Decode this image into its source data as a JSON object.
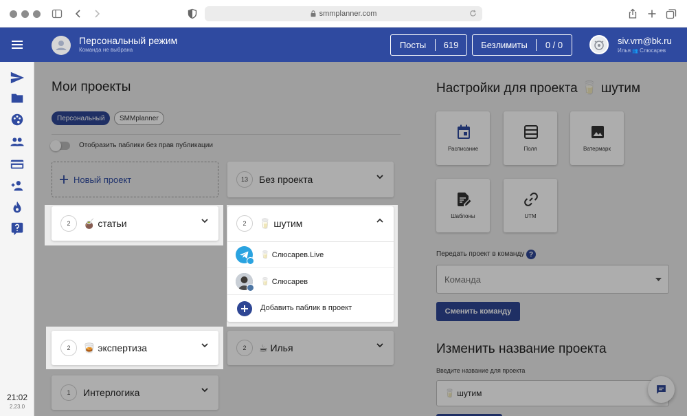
{
  "browser": {
    "url": "smmplanner.com"
  },
  "header": {
    "mode_title": "Персональный режим",
    "mode_subtitle": "Команда не выбрана",
    "posts_label": "Посты",
    "posts_count": "619",
    "unlimited_label": "Безлимиты",
    "unlimited_count": "0 / 0",
    "user_email": "siv.vrn@bk.ru",
    "user_name": "Илья",
    "user_team": "Слюсарев"
  },
  "sidebar": {
    "clock": "21:02",
    "version": "2.23.0"
  },
  "projects": {
    "title": "Мои проекты",
    "chips": [
      "Персональный",
      "SMMplanner"
    ],
    "toggle_label": "Отобразить паблики без прав публикации",
    "new_project": "Новый проект",
    "cards": [
      {
        "count": "13",
        "name": "Без проекта"
      },
      {
        "count": "2",
        "name": "🧉 статьи"
      },
      {
        "count": "2",
        "name": "🥛 шутим"
      },
      {
        "count": "2",
        "name": "🥃 экспертиза"
      },
      {
        "count": "2",
        "name": "☕ Илья"
      },
      {
        "count": "1",
        "name": "Интерлогика"
      }
    ],
    "publics": [
      "🥛 Слюсарев.Live",
      "🥛 Слюсарев"
    ],
    "add_public": "Добавить паблик в проект"
  },
  "settings": {
    "title": "Настройки для проекта 🥛 шутим",
    "tiles": [
      "Расписание",
      "Поля",
      "Ватермарк",
      "Шаблоны",
      "UTM"
    ],
    "transfer_label": "Передать проект в команду",
    "team_placeholder": "Команда",
    "change_team_button": "Сменить команду",
    "rename_title": "Изменить название проекта",
    "rename_label": "Введите название для проекта",
    "rename_value": "🥛 шутим"
  },
  "colors": {
    "brand": "#2f4aa0",
    "primary_button": "#2e4694",
    "telegram": "#2aa3e0"
  }
}
